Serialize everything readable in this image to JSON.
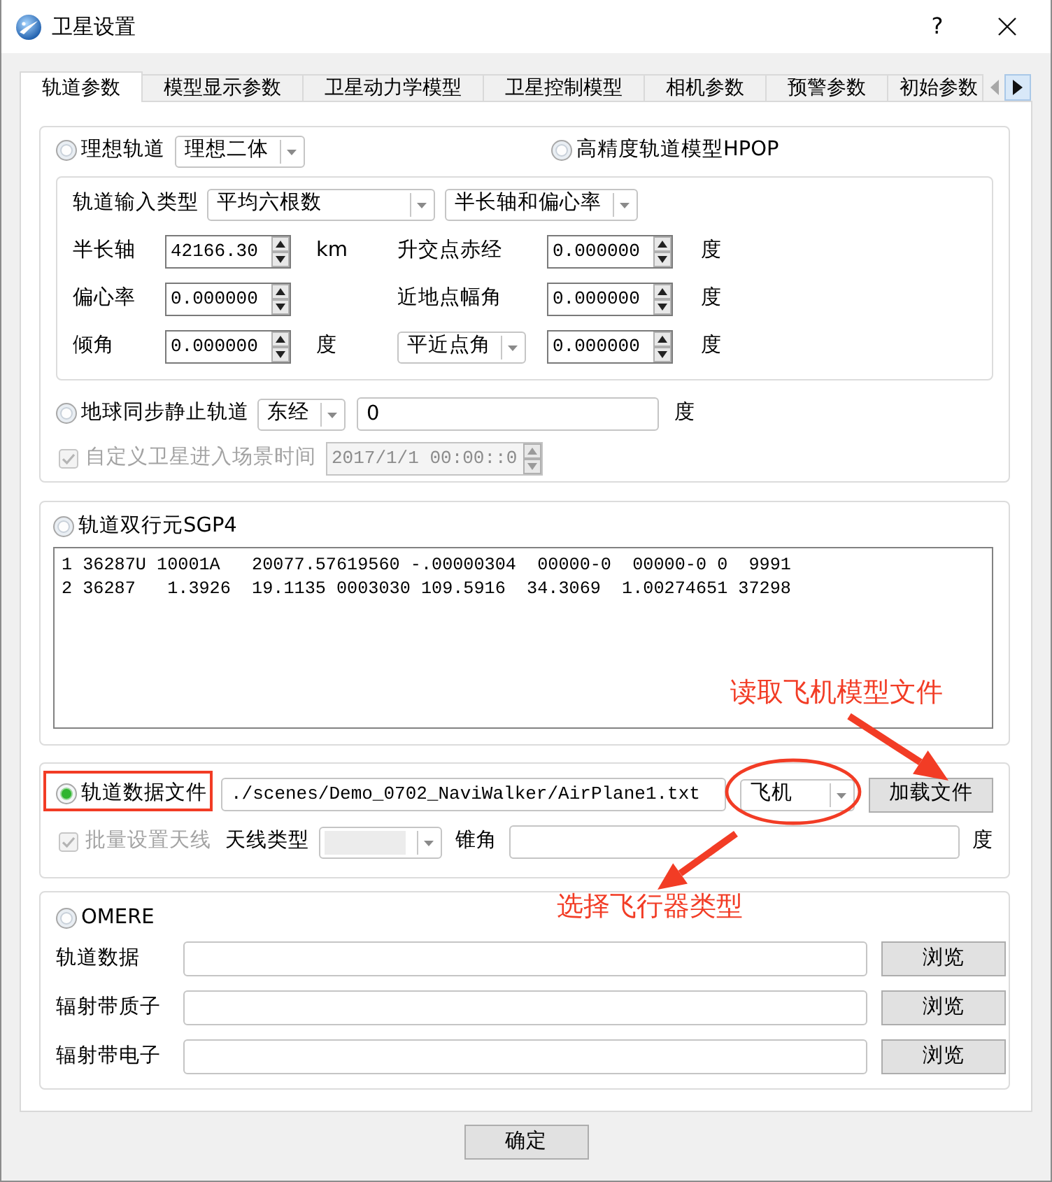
{
  "window": {
    "title": "卫星设置",
    "help": "?"
  },
  "tabs": [
    {
      "label": "轨道参数",
      "selected": true
    },
    {
      "label": "模型显示参数",
      "selected": false
    },
    {
      "label": "卫星动力学模型",
      "selected": false
    },
    {
      "label": "卫星控制模型",
      "selected": false
    },
    {
      "label": "相机参数",
      "selected": false
    },
    {
      "label": "预警参数",
      "selected": false
    },
    {
      "label": "初始参数",
      "selected": false
    }
  ],
  "tab_scroll": {
    "back_disabled": true
  },
  "ideal_orbit": {
    "radio": {
      "label": "理想轨道",
      "selected": false
    },
    "model_combo": {
      "value": "理想二体"
    }
  },
  "hpop": {
    "radio": {
      "label": "高精度轨道模型HPOP",
      "selected": false
    }
  },
  "orbit_input": {
    "label": "轨道输入类型",
    "type_combo": {
      "value": "平均六根数"
    },
    "param_combo": {
      "value": "半长轴和偏心率"
    },
    "element_rows": [
      {
        "left": {
          "label": "半长轴",
          "value": "42166.30",
          "unit": "km"
        },
        "right": {
          "kind": "text",
          "label": "升交点赤经",
          "value": "0.000000",
          "unit": "度"
        }
      },
      {
        "left": {
          "label": "偏心率",
          "value": "0.000000"
        },
        "right": {
          "kind": "text",
          "label": "近地点幅角",
          "value": "0.000000",
          "unit": "度"
        }
      },
      {
        "left": {
          "label": "倾角",
          "value": "0.000000",
          "unit": "度"
        },
        "right": {
          "kind": "combo",
          "label": "平近点角",
          "value": "0.000000",
          "unit": "度"
        }
      }
    ]
  },
  "geo_orbit": {
    "radio": {
      "label": "地球同步静止轨道",
      "selected": false
    },
    "direction_combo": {
      "value": "东经"
    },
    "longitude": {
      "value": "0"
    },
    "unit": "度"
  },
  "entry_time": {
    "checkbox": {
      "label": "自定义卫星进入场景时间",
      "checked": true,
      "disabled": true
    },
    "datetime": {
      "value": "2017/1/1 00:00::0",
      "disabled": true
    }
  },
  "sgp4": {
    "radio": {
      "label": "轨道双行元SGP4",
      "selected": false
    },
    "tle_lines": [
      "1 36287U 10001A   20077.57619560 -.00000304  00000-0  00000-0 0  9991",
      "2 36287   1.3926  19.1135 0003030 109.5916  34.3069  1.00274651 37298"
    ]
  },
  "orbit_file": {
    "radio": {
      "label": "轨道数据文件",
      "selected": true,
      "highlighted": true
    },
    "path": {
      "value": "./scenes/Demo_0702_NaviWalker/AirPlane1.txt"
    },
    "vehicle_combo": {
      "value": "飞机",
      "highlighted": true
    },
    "load_button": "加载文件",
    "antenna_checkbox": {
      "label": "批量设置天线",
      "checked": true,
      "disabled": true
    },
    "antenna_type_label": "天线类型",
    "cone_angle_label": "锥角",
    "unit": "度"
  },
  "omere": {
    "radio": {
      "label": "OMERE",
      "selected": false
    },
    "files": [
      {
        "label": "轨道数据",
        "button": "浏览"
      },
      {
        "label": "辐射带质子",
        "button": "浏览"
      },
      {
        "label": "辐射带电子",
        "button": "浏览"
      }
    ]
  },
  "ok_button": "确定",
  "callouts": [
    {
      "text": "读取飞机模型文件"
    },
    {
      "text": "选择飞行器类型"
    }
  ]
}
